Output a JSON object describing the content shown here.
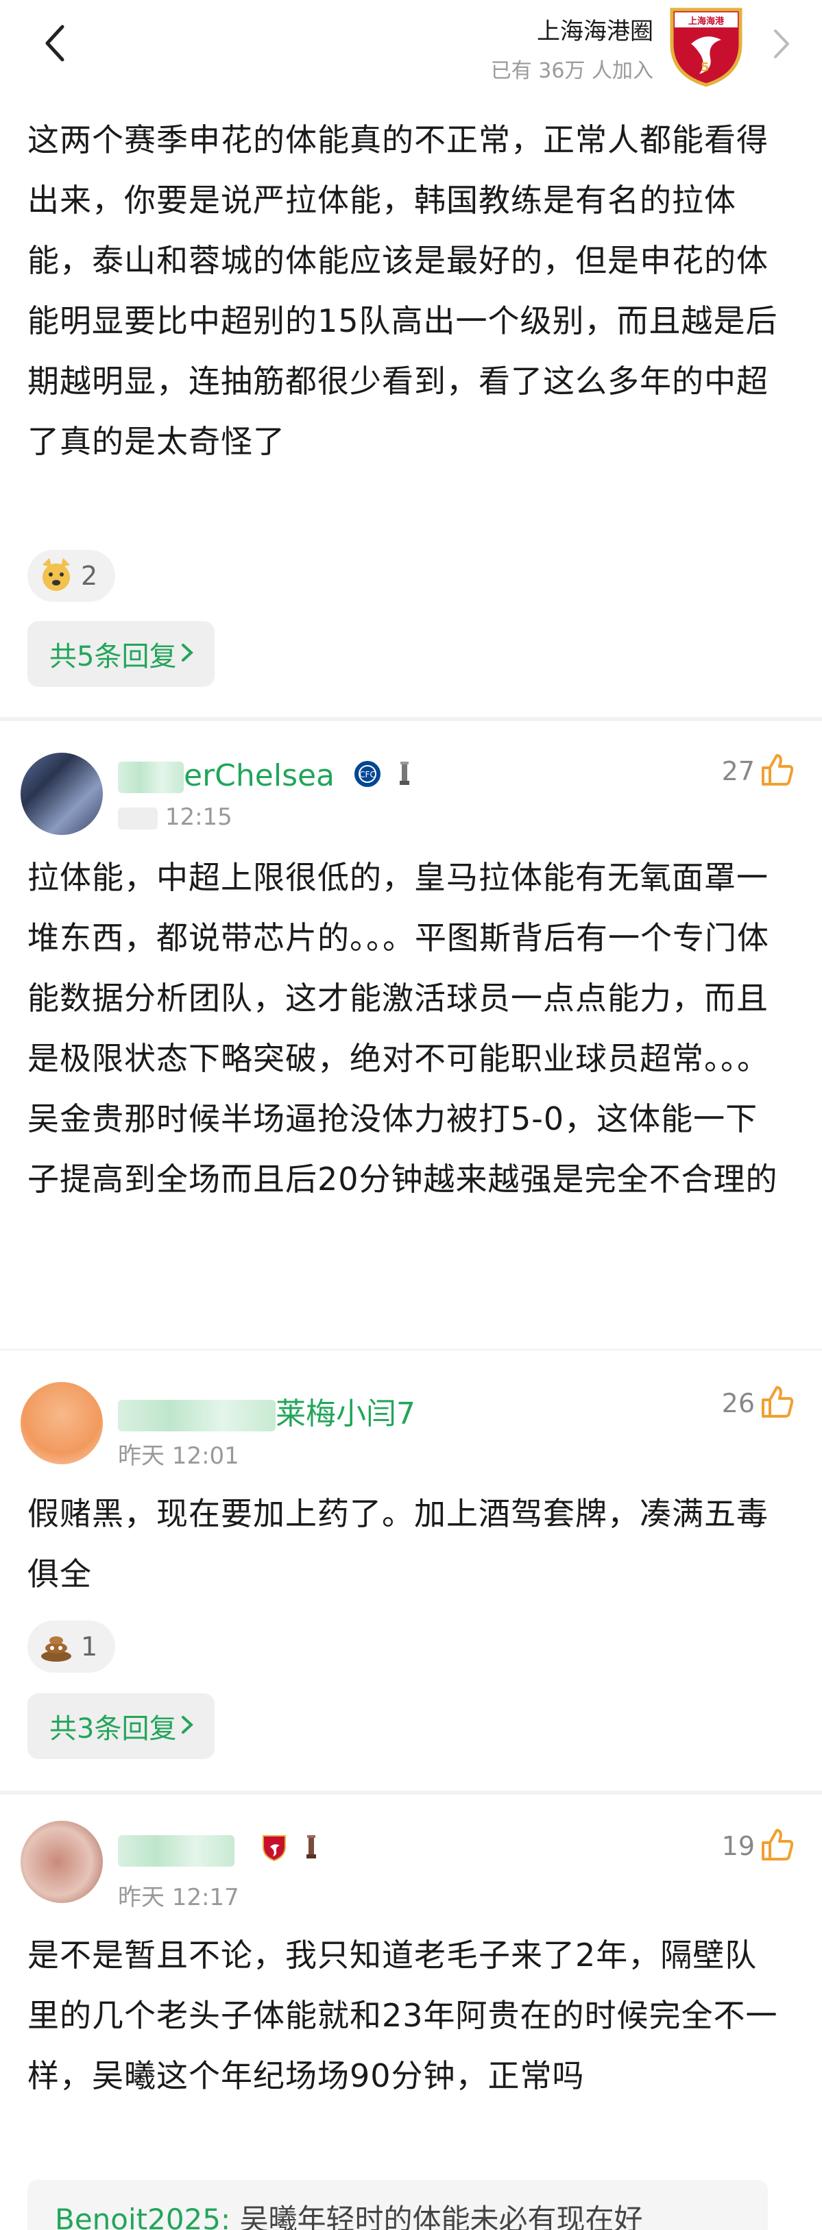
{
  "header": {
    "circle_name": "上海海港圈",
    "member_prefix": "已有",
    "member_count": "36万",
    "member_suffix": "人加入",
    "back_icon": "chevron-left-icon",
    "forward_icon": "chevron-right-icon",
    "colors": {
      "logo_red": "#c8102e",
      "logo_gold": "#e3b23c"
    }
  },
  "post": {
    "body": "这两个赛季申花的体能真的不正常，正常人都能看得出来，你要是说严拉体能，韩国教练是有名的拉体能，泰山和蓉城的体能应该是最好的，但是申花的体能明显要比中超别的15队高出一个级别，而且越是后期越明显，连抽筋都很少看到，看了这么多年的中超了真的是太奇怪了",
    "reaction_icon": "cat-emoji-icon",
    "reaction_count": "2",
    "replies_label": "共5条回复",
    "replies_icon": "chevron-right-icon"
  },
  "comments": [
    {
      "username_visible": "erChelsea",
      "badges": [
        "chelsea-badge-icon",
        "trophy-badge-icon"
      ],
      "time": "12:15",
      "likes": "27",
      "body": "拉体能，中超上限很低的，皇马拉体能有无氧面罩一堆东西，都说带芯片的。。。平图斯背后有一个专门体能数据分析团队，这才能激活球员一点点能力，而且是极限状态下略突破，绝对不可能职业球员超常。。。\n吴金贵那时候半场逼抢没体力被打5-0，这体能一下子提高到全场而且后20分钟越来越强是完全不合理的"
    },
    {
      "username_visible": "莱梅小闫7",
      "badges": [],
      "time": "昨天 12:01",
      "likes": "26",
      "body": "假赌黑，现在要加上药了。加上酒驾套牌，凑满五毒俱全",
      "reaction_icon": "poop-emoji-icon",
      "reaction_count": "1",
      "replies_label": "共3条回复"
    },
    {
      "username_visible": "",
      "badges": [
        "shanghai-port-badge-icon",
        "trophy-badge-icon"
      ],
      "time": "昨天 12:17",
      "likes": "19",
      "body": "是不是暂且不论，我只知道老毛子来了2年，隔壁队里的几个老头子体能就和23年阿贵在的时候完全不一样，吴曦这个年纪场场90分钟，正常吗",
      "quote_name": "Benoit2025:",
      "quote_text": " 吴曦年轻时的体能未必有现在好"
    }
  ],
  "like_icon": "thumbs-up-icon",
  "accent_color": "#22a55a",
  "like_color": "#f0a030"
}
